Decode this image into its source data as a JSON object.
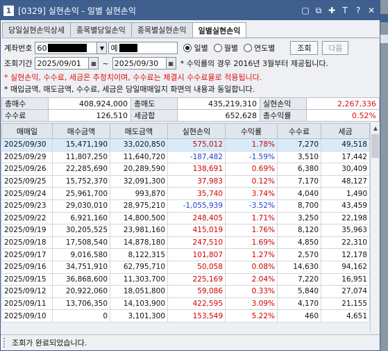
{
  "window": {
    "num": "1",
    "title": "[0329] 실현손익 - 일별 실현손익",
    "icons": [
      "restore-icon",
      "window-icon",
      "pin-icon",
      "font-icon",
      "help-icon",
      "close-icon"
    ]
  },
  "tabs": [
    "당일실현손익상세",
    "종목별당일손익",
    "종목별실현손익",
    "일별실현손익"
  ],
  "active_tab": 3,
  "form": {
    "account_label": "계좌번호",
    "account_value": "60",
    "pw_value": "예",
    "period_label": "조회기간",
    "date_from": "2025/09/01",
    "tilde": "~",
    "date_to": "2025/09/30",
    "radios": [
      "일별",
      "월별",
      "연도별"
    ],
    "selected_radio": 0,
    "query_button": "조회",
    "next_button": "다음",
    "note_rate": "* 수익률의 경우 2016년 3월부터 제공됩니다.",
    "note_red": "* 실현손익, 수수료, 세금은 추정치이며, 수수료는 체결시 수수료율로 적용됩니다.",
    "note_black": "* 매입금액, 매도금액, 수수료, 세금은 당일매매일지 화면의 내용과 동일합니다."
  },
  "summary": {
    "r1": [
      {
        "label": "총매수",
        "value": "408,924,000"
      },
      {
        "label": "총매도",
        "value": "435,219,310"
      },
      {
        "label": "실현손익",
        "value": "2,267,336"
      }
    ],
    "r2": [
      {
        "label": "수수료",
        "value": "126,510"
      },
      {
        "label": "세금합",
        "value": "652,628"
      },
      {
        "label": "총수익률",
        "value": "0.52%"
      }
    ]
  },
  "grid": {
    "headers": [
      "매매일",
      "매수금액",
      "매도금액",
      "실현손익",
      "수익률",
      "수수료",
      "세금"
    ],
    "rows": [
      [
        "2025/09/30",
        "15,471,190",
        "33,020,850",
        "575,012",
        "1.78%",
        "7,270",
        "49,518"
      ],
      [
        "2025/09/29",
        "11,807,250",
        "11,640,720",
        "-187,482",
        "-1.59%",
        "3,510",
        "17,442"
      ],
      [
        "2025/09/26",
        "22,285,690",
        "20,289,590",
        "138,691",
        "0.69%",
        "6,380",
        "30,409"
      ],
      [
        "2025/09/25",
        "15,752,370",
        "32,091,300",
        "37,983",
        "0.12%",
        "7,170",
        "48,127"
      ],
      [
        "2025/09/24",
        "25,961,700",
        "993,870",
        "35,740",
        "3.74%",
        "4,040",
        "1,490"
      ],
      [
        "2025/09/23",
        "29,030,010",
        "28,975,210",
        "-1,055,939",
        "-3.52%",
        "8,700",
        "43,459"
      ],
      [
        "2025/09/22",
        "6,921,160",
        "14,800,500",
        "248,405",
        "1.71%",
        "3,250",
        "22,198"
      ],
      [
        "2025/09/19",
        "30,205,525",
        "23,981,160",
        "415,019",
        "1.76%",
        "8,120",
        "35,963"
      ],
      [
        "2025/09/18",
        "17,508,540",
        "14,878,180",
        "247,510",
        "1.69%",
        "4,850",
        "22,310"
      ],
      [
        "2025/09/17",
        "9,016,580",
        "8,122,315",
        "101,807",
        "1.27%",
        "2,570",
        "12,178"
      ],
      [
        "2025/09/16",
        "34,751,910",
        "62,795,710",
        "50,058",
        "0.08%",
        "14,630",
        "94,162"
      ],
      [
        "2025/09/15",
        "36,868,600",
        "11,303,700",
        "225,169",
        "2.04%",
        "7,220",
        "16,951"
      ],
      [
        "2025/09/12",
        "20,922,060",
        "18,051,800",
        "59,086",
        "0.33%",
        "5,840",
        "27,074"
      ],
      [
        "2025/09/11",
        "13,706,350",
        "14,103,900",
        "422,595",
        "3.09%",
        "4,170",
        "21,155"
      ],
      [
        "2025/09/10",
        "0",
        "3,101,300",
        "153,549",
        "5.22%",
        "460",
        "4,651"
      ]
    ],
    "selected_row": 0
  },
  "status": "조회가 완료되었습니다.",
  "colors": {
    "positive": "#d00000",
    "negative": "#1f3fd0",
    "titlebar": "#3f5f8f",
    "selected_row": "#d7ebfb"
  }
}
